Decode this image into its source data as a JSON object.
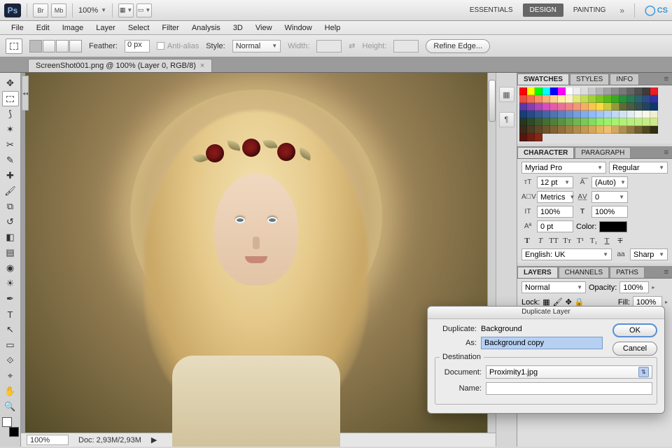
{
  "appbar": {
    "br_label": "Br",
    "mb_label": "Mb",
    "zoom_value": "100%",
    "workspaces": [
      "ESSENTIALS",
      "DESIGN",
      "PAINTING"
    ],
    "cs_label": "CS"
  },
  "menubar": [
    "File",
    "Edit",
    "Image",
    "Layer",
    "Select",
    "Filter",
    "Analysis",
    "3D",
    "View",
    "Window",
    "Help"
  ],
  "optbar": {
    "feather_label": "Feather:",
    "feather_value": "0 px",
    "antialias_label": "Anti-alias",
    "style_label": "Style:",
    "style_value": "Normal",
    "width_label": "Width:",
    "height_label": "Height:",
    "refine_label": "Refine Edge..."
  },
  "tab": {
    "title": "ScreenShot001.png @ 100% (Layer 0, RGB/8)"
  },
  "statusbar": {
    "zoom": "100%",
    "doc": "Doc: 2,93M/2,93M"
  },
  "panels": {
    "swatches_tabs": [
      "SWATCHES",
      "STYLES",
      "INFO"
    ],
    "character_tabs": [
      "CHARACTER",
      "PARAGRAPH"
    ],
    "font_family": "Myriad Pro",
    "font_style": "Regular",
    "size": "12 pt",
    "leading": "(Auto)",
    "kerning": "Metrics",
    "tracking": "0",
    "vscale": "100%",
    "hscale": "100%",
    "baseline": "0 pt",
    "color_label": "Color:",
    "lang": "English: UK",
    "aa_label": "aa",
    "aa_value": "Sharp",
    "layers_tabs": [
      "LAYERS",
      "CHANNELS",
      "PATHS"
    ],
    "blend": "Normal",
    "opacity_label": "Opacity:",
    "opacity": "100%",
    "lock_label": "Lock:",
    "fill_label": "Fill:",
    "fill": "100%"
  },
  "dialog": {
    "title": "Duplicate Layer",
    "dup_label": "Duplicate:",
    "dup_value": "Background",
    "as_label": "As:",
    "as_value": "Background copy",
    "dest_legend": "Destination",
    "doc_label": "Document:",
    "doc_value": "Proximity1.jpg",
    "name_label": "Name:",
    "name_value": "",
    "ok": "OK",
    "cancel": "Cancel"
  },
  "swatch_colors": [
    [
      "#ff0000",
      "#ffff00",
      "#00ff00",
      "#00ffff",
      "#0000ff",
      "#ff00ff",
      "#ffffff",
      "#ededed",
      "#dcdcdc",
      "#c8c8c8",
      "#b4b4b4",
      "#a0a0a0",
      "#8c8c8c",
      "#787878",
      "#646464",
      "#505050",
      "#3c3c3c",
      "#ec1c24"
    ],
    [
      "#ed4b3b",
      "#f26d4f",
      "#f58e63",
      "#f9af78",
      "#fbd08d",
      "#feeea3",
      "#fef4c1",
      "#e0e87a",
      "#c2dd54",
      "#a3d133",
      "#7fc41f",
      "#5bb71a",
      "#39a922",
      "#2a8f3c",
      "#2b7855",
      "#2d616d",
      "#2e4a86",
      "#30349e"
    ],
    [
      "#5a39a6",
      "#8440ae",
      "#ae48b5",
      "#d54fbc",
      "#e65aa8",
      "#ea6f97",
      "#ee8486",
      "#f39975",
      "#f7ae63",
      "#fbc352",
      "#ffd840",
      "#c9c93d",
      "#949a3a",
      "#5e6b37",
      "#4a5c45",
      "#365052",
      "#22445f",
      "#0e386c"
    ],
    [
      "#1a3c77",
      "#274a86",
      "#345894",
      "#4166a3",
      "#4e74b1",
      "#5b82c0",
      "#6890ce",
      "#759edd",
      "#82aceb",
      "#8fbafa",
      "#a0c4f8",
      "#b0cef6",
      "#c1d8f4",
      "#d1e2f2",
      "#e2ecf0",
      "#f2f6ee",
      "#faf6e6",
      "#f0eed0"
    ],
    [
      "#24381f",
      "#2f4a26",
      "#3a5c2d",
      "#456e34",
      "#50803b",
      "#5b9242",
      "#66a449",
      "#71b650",
      "#7cc857",
      "#87da5e",
      "#92ec65",
      "#9df06c",
      "#a8f273",
      "#b2f177",
      "#b9ef7c",
      "#bfee80",
      "#c6ec84",
      "#cceb88"
    ],
    [
      "#3b2a19",
      "#4d3820",
      "#5e4627",
      "#6f542e",
      "#806235",
      "#91703c",
      "#a27e43",
      "#b38c4a",
      "#c49a51",
      "#d5a858",
      "#e6b65f",
      "#f0c070",
      "#d0a860",
      "#b09050",
      "#907840",
      "#706030",
      "#504820",
      "#303010"
    ],
    [
      "#56170e",
      "#6e1f13",
      "#872718"
    ]
  ]
}
